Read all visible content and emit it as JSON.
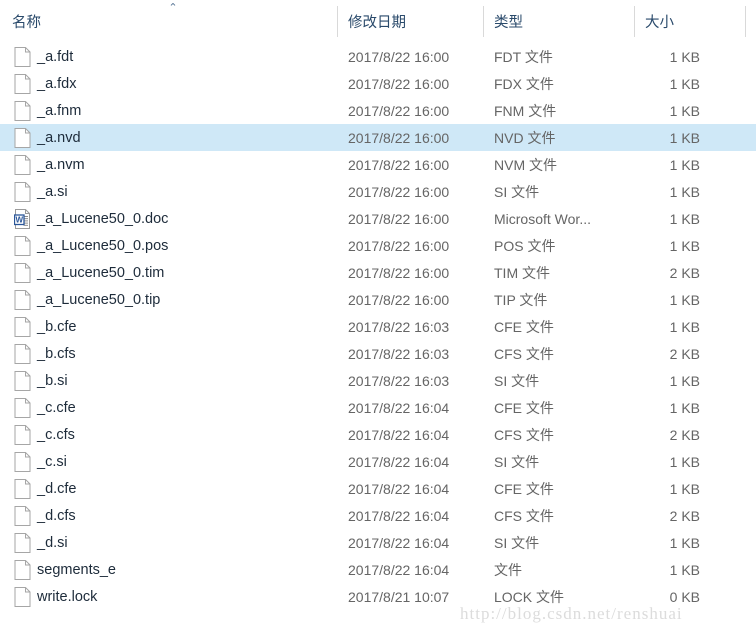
{
  "header": {
    "columns": [
      {
        "key": "name",
        "label": "名称"
      },
      {
        "key": "date",
        "label": "修改日期"
      },
      {
        "key": "type",
        "label": "类型"
      },
      {
        "key": "size",
        "label": "大小"
      }
    ],
    "sort": {
      "column": "名称",
      "direction": "ascending",
      "glyph": "⌃"
    }
  },
  "colors": {
    "selection": "#cfe8f7",
    "header_text": "#2a4a6b",
    "row_text": "#1d2b3a",
    "secondary_text": "#656565",
    "divider": "#d9d9d9",
    "watermark": "#dcdcdc"
  },
  "files": [
    {
      "name": "_a.fdt",
      "date": "2017/8/22 16:00",
      "type": "FDT 文件",
      "size": "1 KB",
      "icon": "generic-file-icon",
      "selected": false
    },
    {
      "name": "_a.fdx",
      "date": "2017/8/22 16:00",
      "type": "FDX 文件",
      "size": "1 KB",
      "icon": "generic-file-icon",
      "selected": false
    },
    {
      "name": "_a.fnm",
      "date": "2017/8/22 16:00",
      "type": "FNM 文件",
      "size": "1 KB",
      "icon": "generic-file-icon",
      "selected": false
    },
    {
      "name": "_a.nvd",
      "date": "2017/8/22 16:00",
      "type": "NVD 文件",
      "size": "1 KB",
      "icon": "generic-file-icon",
      "selected": true
    },
    {
      "name": "_a.nvm",
      "date": "2017/8/22 16:00",
      "type": "NVM 文件",
      "size": "1 KB",
      "icon": "generic-file-icon",
      "selected": false
    },
    {
      "name": "_a.si",
      "date": "2017/8/22 16:00",
      "type": "SI 文件",
      "size": "1 KB",
      "icon": "generic-file-icon",
      "selected": false
    },
    {
      "name": "_a_Lucene50_0.doc",
      "date": "2017/8/22 16:00",
      "type": "Microsoft Wor...",
      "size": "1 KB",
      "icon": "word-document-icon",
      "selected": false
    },
    {
      "name": "_a_Lucene50_0.pos",
      "date": "2017/8/22 16:00",
      "type": "POS 文件",
      "size": "1 KB",
      "icon": "generic-file-icon",
      "selected": false
    },
    {
      "name": "_a_Lucene50_0.tim",
      "date": "2017/8/22 16:00",
      "type": "TIM 文件",
      "size": "2 KB",
      "icon": "generic-file-icon",
      "selected": false
    },
    {
      "name": "_a_Lucene50_0.tip",
      "date": "2017/8/22 16:00",
      "type": "TIP 文件",
      "size": "1 KB",
      "icon": "generic-file-icon",
      "selected": false
    },
    {
      "name": "_b.cfe",
      "date": "2017/8/22 16:03",
      "type": "CFE 文件",
      "size": "1 KB",
      "icon": "generic-file-icon",
      "selected": false
    },
    {
      "name": "_b.cfs",
      "date": "2017/8/22 16:03",
      "type": "CFS 文件",
      "size": "2 KB",
      "icon": "generic-file-icon",
      "selected": false
    },
    {
      "name": "_b.si",
      "date": "2017/8/22 16:03",
      "type": "SI 文件",
      "size": "1 KB",
      "icon": "generic-file-icon",
      "selected": false
    },
    {
      "name": "_c.cfe",
      "date": "2017/8/22 16:04",
      "type": "CFE 文件",
      "size": "1 KB",
      "icon": "generic-file-icon",
      "selected": false
    },
    {
      "name": "_c.cfs",
      "date": "2017/8/22 16:04",
      "type": "CFS 文件",
      "size": "2 KB",
      "icon": "generic-file-icon",
      "selected": false
    },
    {
      "name": "_c.si",
      "date": "2017/8/22 16:04",
      "type": "SI 文件",
      "size": "1 KB",
      "icon": "generic-file-icon",
      "selected": false
    },
    {
      "name": "_d.cfe",
      "date": "2017/8/22 16:04",
      "type": "CFE 文件",
      "size": "1 KB",
      "icon": "generic-file-icon",
      "selected": false
    },
    {
      "name": "_d.cfs",
      "date": "2017/8/22 16:04",
      "type": "CFS 文件",
      "size": "2 KB",
      "icon": "generic-file-icon",
      "selected": false
    },
    {
      "name": "_d.si",
      "date": "2017/8/22 16:04",
      "type": "SI 文件",
      "size": "1 KB",
      "icon": "generic-file-icon",
      "selected": false
    },
    {
      "name": "segments_e",
      "date": "2017/8/22 16:04",
      "type": "文件",
      "size": "1 KB",
      "icon": "generic-file-icon",
      "selected": false
    },
    {
      "name": "write.lock",
      "date": "2017/8/21 10:07",
      "type": "LOCK 文件",
      "size": "0 KB",
      "icon": "generic-file-icon",
      "selected": false
    }
  ],
  "watermark": {
    "text": "http://blog.csdn.net/renshuai"
  }
}
